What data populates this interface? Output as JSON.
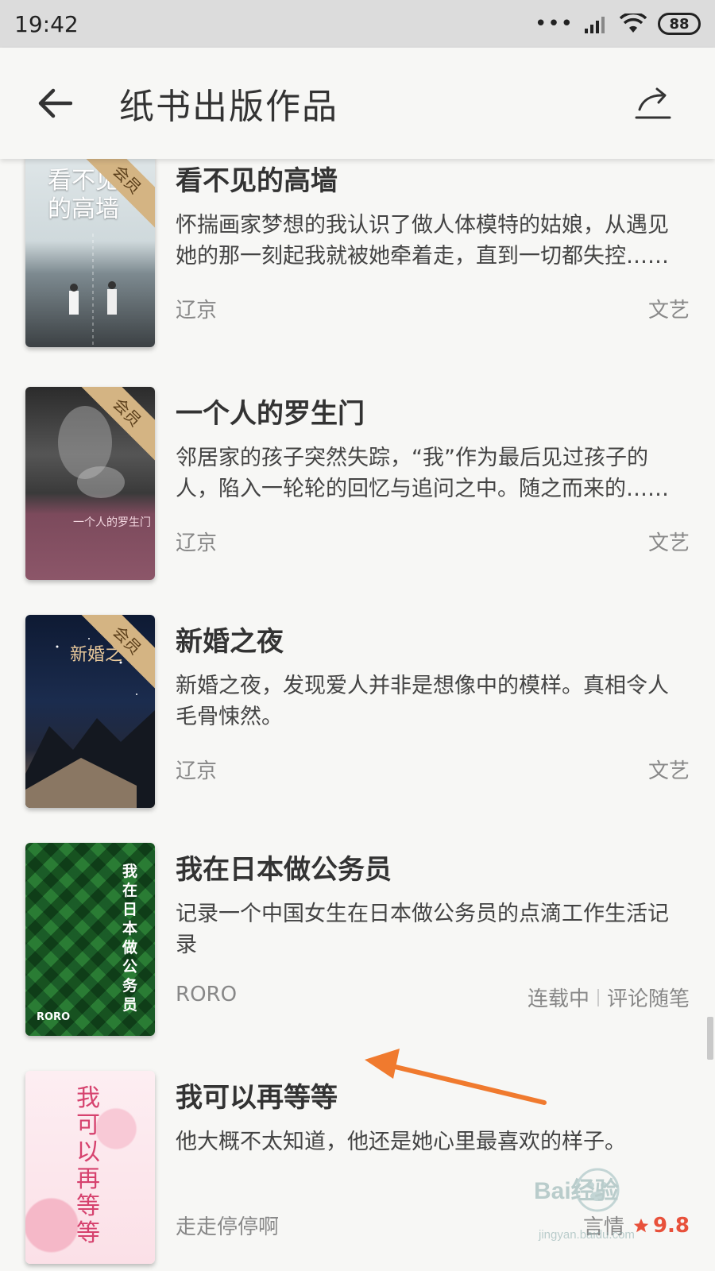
{
  "status_bar": {
    "time": "19:42",
    "battery": "88"
  },
  "app_bar": {
    "title": "纸书出版作品"
  },
  "books": [
    {
      "title": "看不见的高墙",
      "description": "怀揣画家梦想的我认识了做人体模特的姑娘，从遇见她的那一刻起我就被她牵着走，直到一切都失控……",
      "author": "辽京",
      "category": "文艺",
      "badge": "会员",
      "cover_text": "看不见的高墙"
    },
    {
      "title": "一个人的罗生门",
      "description": "邻居家的孩子突然失踪，“我”作为最后见过孩子的人，陷入一轮轮的回忆与追问之中。随之而来的……",
      "author": "辽京",
      "category": "文艺",
      "badge": "会员",
      "cover_text": "一个人的罗生门"
    },
    {
      "title": "新婚之夜",
      "description": "新婚之夜，发现爱人并非是想像中的模样。真相令人毛骨悚然。",
      "author": "辽京",
      "category": "文艺",
      "badge": "会员",
      "cover_text": "新婚之"
    },
    {
      "title": "我在日本做公务员",
      "description": "记录一个中国女生在日本做公务员的点滴工作生活记录",
      "author": "RORO",
      "status": "连载中",
      "category": "评论随笔",
      "cover_text": "我在日本做公务员",
      "cover_author": "RORO"
    },
    {
      "title": "我可以再等等",
      "description": "他大概不太知道，他还是她心里最喜欢的样子。",
      "author": "走走停停啊",
      "category": "言情",
      "rating": "9.8",
      "cover_text": "我可以再等等"
    }
  ],
  "watermark": {
    "text": "Bai经验",
    "sub": "jingyan.baidu.com"
  },
  "colors": {
    "rating": "#e8513b",
    "badge": "#d4b483",
    "annotation_arrow": "#f07a2e"
  }
}
